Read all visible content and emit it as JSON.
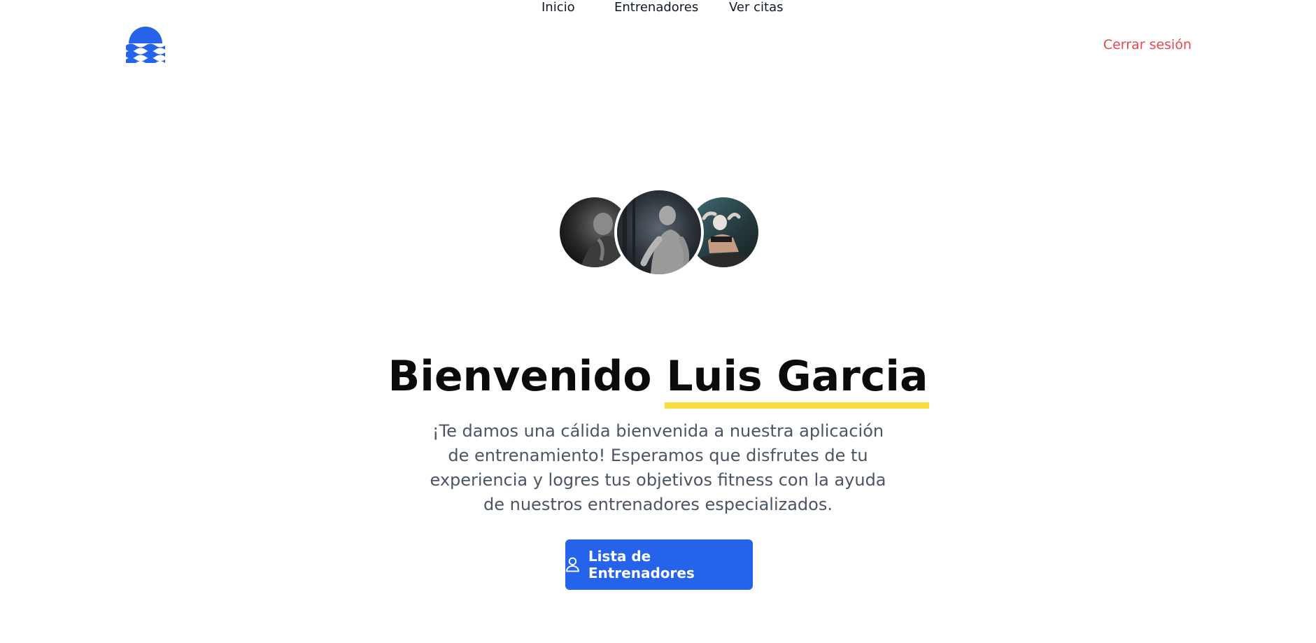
{
  "colors": {
    "brand": "#2563eb",
    "logout": "#e5484d",
    "highlight": "#f8dd3f",
    "heading": "#0b0b0b",
    "body_text": "#4b5563"
  },
  "header": {
    "logo_icon": "waves-logo-icon",
    "nav": [
      {
        "label": "Inicio"
      },
      {
        "label": "Entrenadores"
      },
      {
        "label": "Ver citas"
      }
    ],
    "logout_label": "Cerrar sesión"
  },
  "hero": {
    "avatars": [
      "trainer-photo-1",
      "trainer-photo-2",
      "trainer-photo-3"
    ],
    "title_prefix": "Bienvenido",
    "user_name": "Luis Garcia",
    "description": "¡Te damos una cálida bienvenida a nuestra aplicación de entrenamiento! Esperamos que disfrutes de tu experiencia y logres tus objetivos fitness con la ayuda de nuestros entrenadores especializados.",
    "cta": {
      "icon": "user-icon",
      "label": "Lista de Entrenadores"
    }
  }
}
